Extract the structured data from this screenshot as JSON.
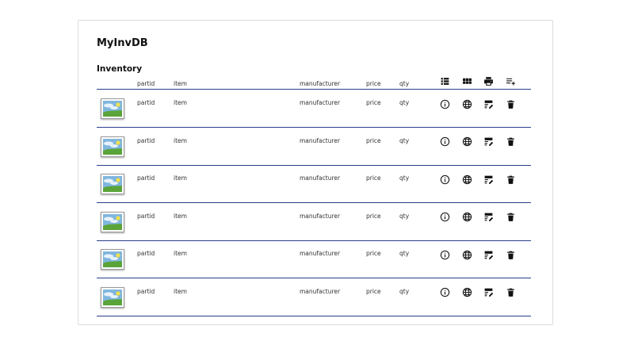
{
  "app": {
    "title": "MyInvDB"
  },
  "inventory": {
    "title": "Inventory",
    "columns": {
      "partid": "partid",
      "item": "item",
      "manufacturer": "manufacturer",
      "price": "price",
      "qty": "qty"
    },
    "header_icons": [
      "list-view-icon",
      "grid-view-icon",
      "print-icon",
      "playlist-add-icon"
    ],
    "row_icons": [
      "info-icon",
      "globe-icon",
      "edit-note-icon",
      "trash-icon"
    ],
    "rows": [
      {
        "partid": "partid",
        "item": "item",
        "manufacturer": "manufacturer",
        "price": "price",
        "qty": "qty"
      },
      {
        "partid": "partid",
        "item": "item",
        "manufacturer": "manufacturer",
        "price": "price",
        "qty": "qty"
      },
      {
        "partid": "partid",
        "item": "item",
        "manufacturer": "manufacturer",
        "price": "price",
        "qty": "qty"
      },
      {
        "partid": "partid",
        "item": "item",
        "manufacturer": "manufacturer",
        "price": "price",
        "qty": "qty"
      },
      {
        "partid": "partid",
        "item": "item",
        "manufacturer": "manufacturer",
        "price": "price",
        "qty": "qty"
      },
      {
        "partid": "partid",
        "item": "item",
        "manufacturer": "manufacturer",
        "price": "price",
        "qty": "qty"
      }
    ]
  },
  "colors": {
    "accent_line": "#2c3e8c",
    "card_border": "#dcdcdc"
  }
}
